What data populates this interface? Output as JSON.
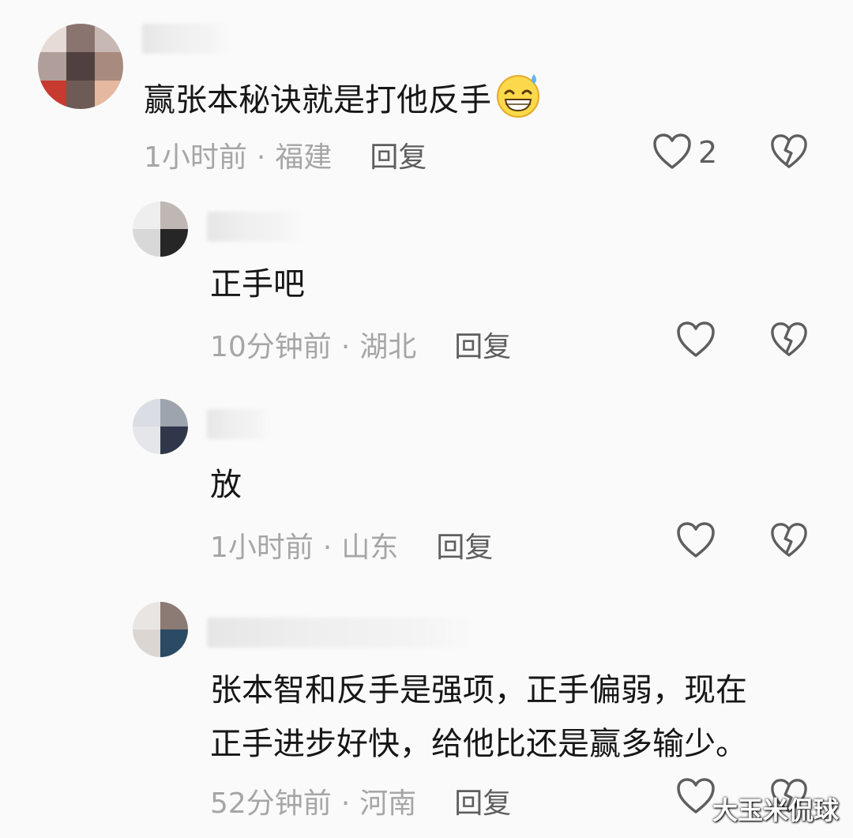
{
  "comments": [
    {
      "text": "赢张本秘诀就是打他反手",
      "time": "1小时前",
      "location": "福建",
      "reply_label": "回复",
      "like_count": "2"
    },
    {
      "text": "正手吧",
      "time": "10分钟前",
      "location": "湖北",
      "reply_label": "回复"
    },
    {
      "text": "放",
      "time": "1小时前",
      "location": "山东",
      "reply_label": "回复"
    },
    {
      "text_lines": [
        "张本智和反手是强项，正手偏弱，现在",
        "正手进步好快，给他比还是赢多输少。"
      ],
      "time": "52分钟前",
      "location": "河南",
      "reply_label": "回复"
    }
  ],
  "separator": "·",
  "watermark": "大玉米侃球",
  "icons": {
    "like": "heart-outline-icon",
    "dislike": "broken-heart-icon",
    "emoji": "grinning-sweat-emoji-icon"
  },
  "colors": {
    "background": "#fafafa",
    "text": "#161616",
    "meta": "#a6a6a6",
    "reply": "#5e5e5e",
    "icon": "#5e5e5e"
  }
}
